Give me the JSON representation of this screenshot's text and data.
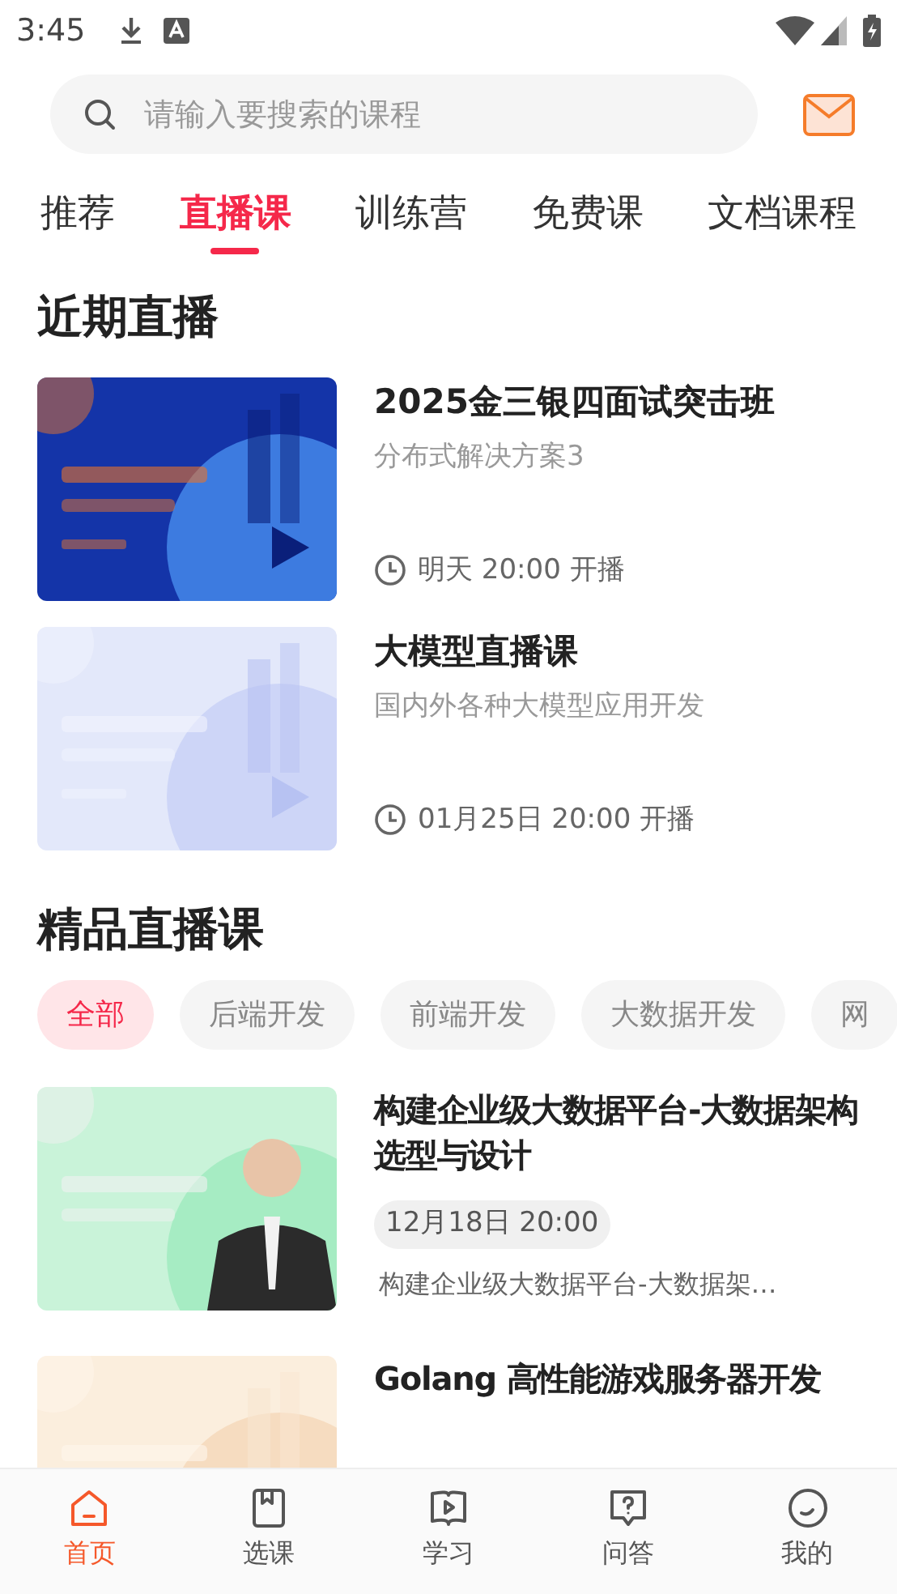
{
  "status_bar": {
    "time": "3:45"
  },
  "search": {
    "placeholder": "请输入要搜索的课程"
  },
  "tabs": [
    {
      "label": "推荐",
      "selected": false
    },
    {
      "label": "直播课",
      "selected": true
    },
    {
      "label": "训练营",
      "selected": false
    },
    {
      "label": "免费课",
      "selected": false
    },
    {
      "label": "文档课程",
      "selected": false
    }
  ],
  "recent_live": {
    "heading": "近期直播",
    "items": [
      {
        "title": "2025金三银四面试突击班",
        "subtitle": "分布式解决方案3",
        "time": "明天 20:00 开播"
      },
      {
        "title": "大模型直播课",
        "subtitle": "国内外各种大模型应用开发",
        "time": "01月25日 20:00 开播"
      }
    ]
  },
  "premium_live": {
    "heading": "精品直播课",
    "filters": [
      {
        "label": "全部",
        "selected": true
      },
      {
        "label": "后端开发",
        "selected": false
      },
      {
        "label": "前端开发",
        "selected": false
      },
      {
        "label": "大数据开发",
        "selected": false
      },
      {
        "label": "网",
        "selected": false
      }
    ],
    "items": [
      {
        "title": "构建企业级大数据平台-大数据架构选型与设计",
        "date": "12月18日 20:00",
        "description": "构建企业级大数据平台-大数据架…"
      },
      {
        "title": "Golang 高性能游戏服务器开发"
      }
    ]
  },
  "bottom_nav": [
    {
      "label": "首页",
      "selected": true
    },
    {
      "label": "选课",
      "selected": false
    },
    {
      "label": "学习",
      "selected": false
    },
    {
      "label": "问答",
      "selected": false
    },
    {
      "label": "我的",
      "selected": false
    }
  ]
}
